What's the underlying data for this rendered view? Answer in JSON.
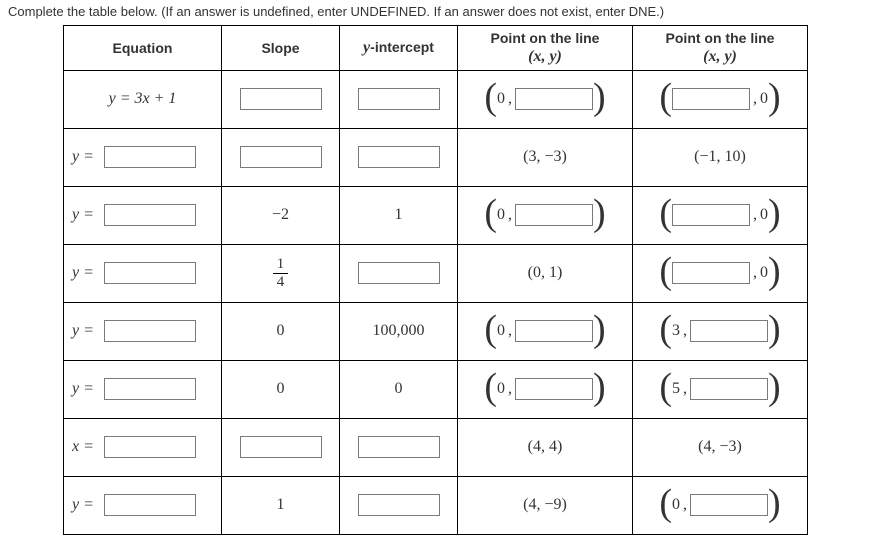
{
  "instruction": "Complete the table below. (If an answer is undefined, enter UNDEFINED. If an answer does not exist, enter DNE.)",
  "headers": {
    "equation": "Equation",
    "slope": "Slope",
    "yint": "y-intercept",
    "p1_a": "Point on the line",
    "p1_b": "(x, y)",
    "p2_a": "Point on the line",
    "p2_b": "(x, y)"
  },
  "rows": {
    "r1": {
      "eq_text": "y = 3x + 1",
      "p1_x": "0",
      "p2_y": "0"
    },
    "r2": {
      "eq_lhs": "y =",
      "p1": "(3, −3)",
      "p2": "(−1, 10)"
    },
    "r3": {
      "eq_lhs": "y =",
      "slope": "−2",
      "yint": "1",
      "p1_x": "0",
      "p2_y": "0"
    },
    "r4": {
      "eq_lhs": "y =",
      "slope_num": "1",
      "slope_den": "4",
      "p1": "(0, 1)",
      "p2_y": "0"
    },
    "r5": {
      "eq_lhs": "y =",
      "slope": "0",
      "yint": "100,000",
      "p1_x": "0",
      "p2_x": "3"
    },
    "r6": {
      "eq_lhs": "y =",
      "slope": "0",
      "yint": "0",
      "p1_x": "0",
      "p2_x": "5"
    },
    "r7": {
      "eq_lhs": "x =",
      "p1": "(4, 4)",
      "p2": "(4, −3)"
    },
    "r8": {
      "eq_lhs": "y =",
      "slope": "1",
      "p1": "(4, −9)",
      "p2_x": "0"
    }
  }
}
